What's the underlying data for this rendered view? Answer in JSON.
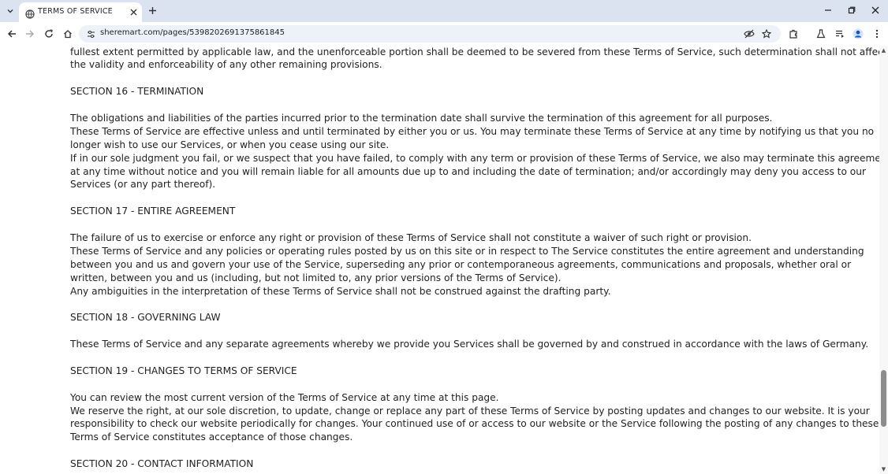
{
  "browser": {
    "tab_title": "TERMS OF SERVICE",
    "url": "sheremart.com/pages/5398202691375861845",
    "icons": {
      "tab_search": "chevron-down-icon",
      "favicon": "globe-icon",
      "tab_close": "close-icon",
      "new_tab": "plus-icon",
      "minimize": "minimize-icon",
      "restore": "restore-icon",
      "close_window": "close-icon",
      "back": "arrow-left-icon",
      "forward": "arrow-right-icon",
      "reload": "reload-icon",
      "home": "home-icon",
      "site_info": "tune-icon",
      "eye_off": "eye-off-icon",
      "bookmark": "star-icon",
      "extensions": "puzzle-icon",
      "labs": "flask-icon",
      "media": "playlist-icon",
      "profile": "avatar-icon",
      "menu": "kebab-menu-icon"
    },
    "accent_color": "#dbe3f1"
  },
  "doc": {
    "lines": [
      "fullest extent permitted by applicable law, and the unenforceable portion shall be deemed to be severed from these Terms of Service, such determination shall not affect",
      "the validity and enforceability of any other remaining provisions.",
      "",
      "SECTION 16 - TERMINATION",
      "",
      "The obligations and liabilities of the parties incurred prior to the termination date shall survive the termination of this agreement for all purposes.",
      "These Terms of Service are effective unless and until terminated by either you or us. You may terminate these Terms of Service at any time by notifying us that you no",
      "longer wish to use our Services, or when you cease using our site.",
      "If in our sole judgment you fail, or we suspect that you have failed, to comply with any term or provision of these Terms of Service, we also may terminate this agreement",
      "at any time without notice and you will remain liable for all amounts due up to and including the date of termination; and/or accordingly may deny you access to our",
      "Services (or any part thereof).",
      "",
      "SECTION 17 - ENTIRE AGREEMENT",
      "",
      "The failure of us to exercise or enforce any right or provision of these Terms of Service shall not constitute a waiver of such right or provision.",
      "These Terms of Service and any policies or operating rules posted by us on this site or in respect to The Service constitutes the entire agreement and understanding",
      "between you and us and govern your use of the Service, superseding any prior or contemporaneous agreements, communications and proposals, whether oral or",
      "written, between you and us (including, but not limited to, any prior versions of the Terms of Service).",
      "Any ambiguities in the interpretation of these Terms of Service shall not be construed against the drafting party.",
      "",
      "SECTION 18 - GOVERNING LAW",
      "",
      "These Terms of Service and any separate agreements whereby we provide you Services shall be governed by and construed in accordance with the laws of Germany.",
      "",
      "SECTION 19 - CHANGES TO TERMS OF SERVICE",
      "",
      "You can review the most current version of the Terms of Service at any time at this page.",
      "We reserve the right, at our sole discretion, to update, change or replace any part of these Terms of Service by posting updates and changes to our website. It is your",
      "responsibility to check our website periodically for changes. Your continued use of or access to our website or the Service following the posting of any changes to these",
      "Terms of Service constitutes acceptance of those changes.",
      "",
      "SECTION 20 - CONTACT INFORMATION"
    ]
  },
  "scrollbar": {
    "position_fraction": 0.78
  }
}
